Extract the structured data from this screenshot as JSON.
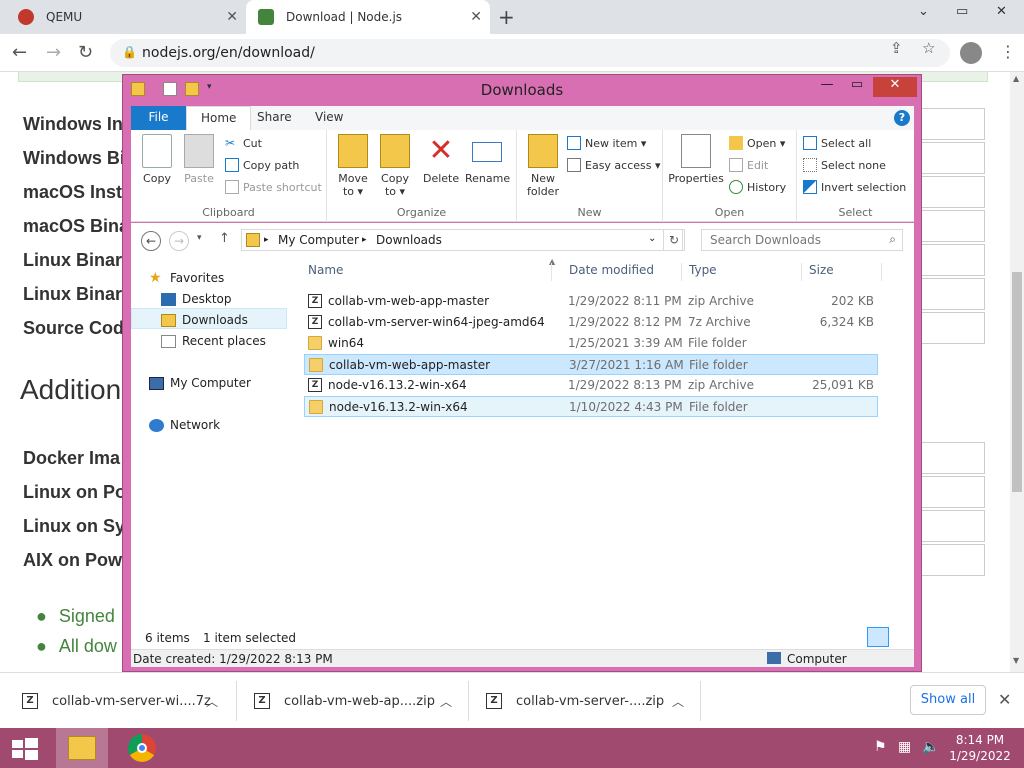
{
  "browser": {
    "tabs": [
      {
        "label": "QEMU"
      },
      {
        "label": "Download | Node.js"
      }
    ],
    "new_tab": "+",
    "url": "nodejs.org/en/download/",
    "window_controls": {
      "minimize": "⌄",
      "restore": "▭",
      "close": "✕"
    }
  },
  "page": {
    "downloads": [
      "Windows In",
      "Windows Bi",
      "macOS Insta",
      "macOS Bina",
      "Linux Binar",
      "Linux Binar",
      "Source Code"
    ],
    "additional_heading": "Addition",
    "additional": [
      "Docker Ima",
      "Linux on Po",
      "Linux on Sy",
      "AIX on Powe"
    ],
    "bullets": [
      "Signed",
      "All dow"
    ]
  },
  "explorer": {
    "title": "Downloads",
    "tabs": {
      "file": "File",
      "home": "Home",
      "share": "Share",
      "view": "View"
    },
    "help": "?",
    "clipboard": {
      "copy": "Copy",
      "paste": "Paste",
      "cut": "Cut",
      "copy_path": "Copy path",
      "paste_shortcut": "Paste shortcut",
      "label": "Clipboard"
    },
    "organize": {
      "move_to": "Move to ▾",
      "copy_to": "Copy to ▾",
      "delete": "Delete",
      "rename": "Rename",
      "label": "Organize"
    },
    "new": {
      "new_folder": "New folder",
      "new_item": "New item ▾",
      "easy_access": "Easy access ▾",
      "label": "New"
    },
    "open": {
      "properties": "Properties",
      "open": "Open ▾",
      "edit": "Edit",
      "history": "History",
      "label": "Open"
    },
    "select": {
      "select_all": "Select all",
      "select_none": "Select none",
      "invert": "Invert selection",
      "label": "Select"
    },
    "path": {
      "root": "My Computer",
      "current": "Downloads"
    },
    "search_placeholder": "Search Downloads",
    "nav": {
      "favorites": "Favorites",
      "desktop": "Desktop",
      "downloads": "Downloads",
      "recent": "Recent places",
      "computer": "My Computer",
      "network": "Network"
    },
    "columns": {
      "name": "Name",
      "date": "Date modified",
      "type": "Type",
      "size": "Size"
    },
    "files": [
      {
        "name": "collab-vm-web-app-master",
        "date": "1/29/2022 8:11 PM",
        "type": "zip Archive",
        "size": "202 KB"
      },
      {
        "name": "collab-vm-server-win64-jpeg-amd64",
        "date": "1/29/2022 8:12 PM",
        "type": "7z Archive",
        "size": "6,324 KB"
      },
      {
        "name": "win64",
        "date": "1/25/2021 3:39 AM",
        "type": "File folder",
        "size": ""
      },
      {
        "name": "collab-vm-web-app-master",
        "date": "3/27/2021 1:16 AM",
        "type": "File folder",
        "size": ""
      },
      {
        "name": "node-v16.13.2-win-x64",
        "date": "1/29/2022 8:13 PM",
        "type": "zip Archive",
        "size": "25,091 KB"
      },
      {
        "name": "node-v16.13.2-win-x64",
        "date": "1/10/2022 4:43 PM",
        "type": "File folder",
        "size": ""
      }
    ],
    "status": {
      "count": "6 items",
      "selected": "1 item selected"
    },
    "details": {
      "created": "Date created: 1/29/2022 8:13 PM",
      "location": "Computer"
    }
  },
  "shelf": {
    "items": [
      "collab-vm-server-wi....7z",
      "collab-vm-web-ap....zip",
      "collab-vm-server-....zip"
    ],
    "show_all": "Show all"
  },
  "taskbar": {
    "time": "8:14 PM",
    "date": "1/29/2022"
  },
  "colors": {
    "explorer_frame": "#d86fb3",
    "taskbar": "#a04a6f",
    "selection": "#cce8ff",
    "file_tab": "#1979ca"
  }
}
